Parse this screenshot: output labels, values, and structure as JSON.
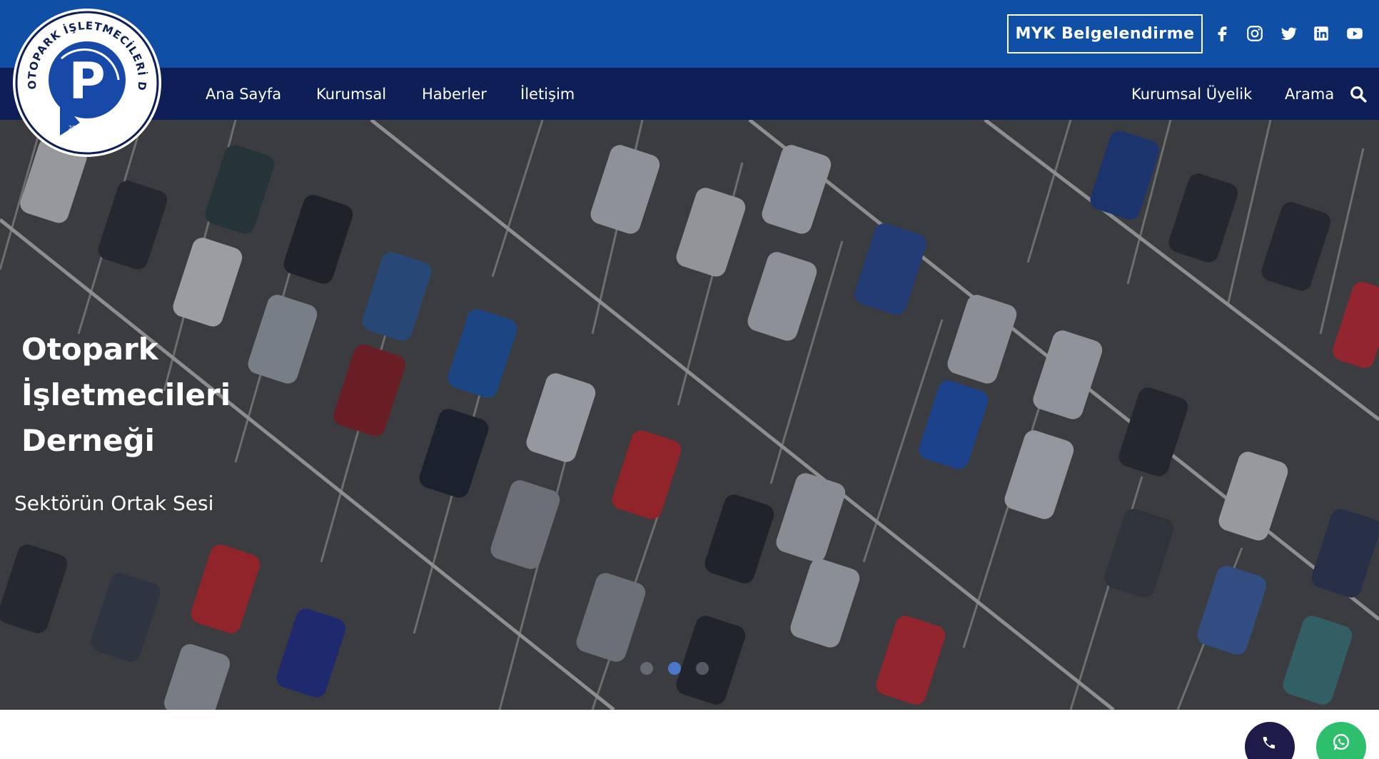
{
  "logo": {
    "text_top": "OTOPARK İŞLETMECİLERİ DERNEĞİ",
    "letter": "P",
    "year": "2014"
  },
  "topbar": {
    "myk_button": "MYK Belgelendirme",
    "social_icons": [
      "facebook-icon",
      "instagram-icon",
      "twitter-icon",
      "linkedin-icon",
      "youtube-icon"
    ]
  },
  "nav": {
    "left": [
      "Ana Sayfa",
      "Kurumsal",
      "Haberler",
      "İletişim"
    ],
    "right": [
      "Kurumsal Üyelik",
      "Arama"
    ],
    "search_icon": "search-icon"
  },
  "hero": {
    "title_lines": [
      "Otopark",
      "İşletmecileri",
      "Derneği"
    ],
    "subtitle": "Sektörün Ortak Sesi",
    "slides": 3,
    "active_slide": 2
  },
  "float": {
    "phone_icon": "phone-icon",
    "whatsapp_icon": "whatsapp-icon"
  },
  "colors": {
    "topbar": "#0f4fa6",
    "navbar": "#0e1f58",
    "phone_button": "#1e1b4b",
    "whatsapp_button": "#2dbf6c"
  }
}
